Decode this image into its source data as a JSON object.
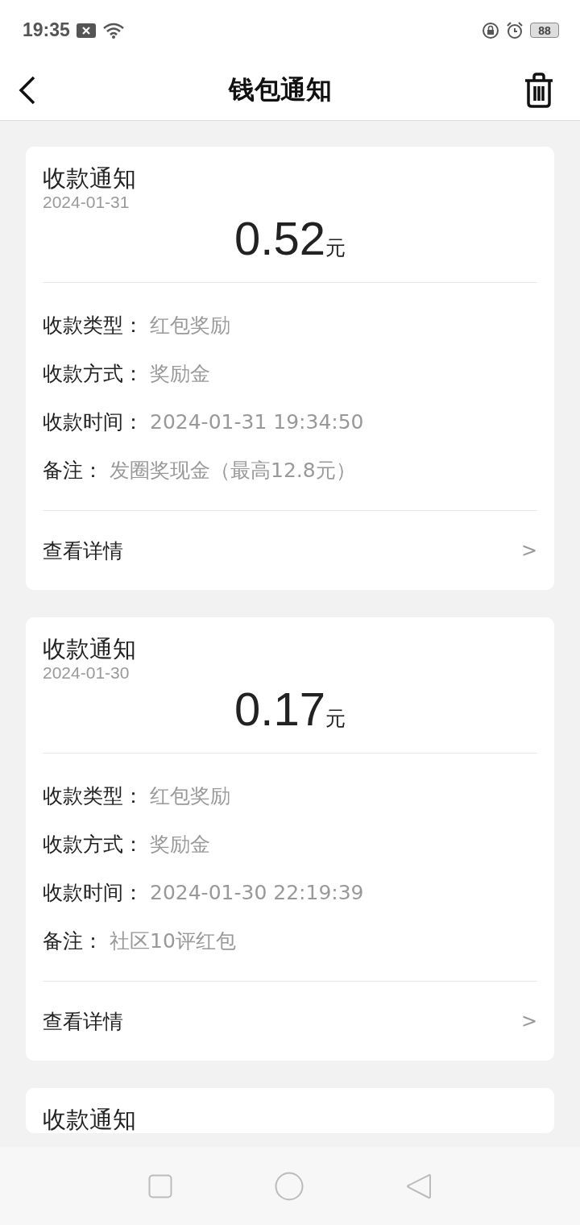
{
  "status_bar": {
    "time": "19:35",
    "battery": "88"
  },
  "header": {
    "title": "钱包通知"
  },
  "notices": [
    {
      "title": "收款通知",
      "date": "2024-01-31",
      "amount": "0.52",
      "unit": "元",
      "fields": [
        {
          "label": "收款类型：",
          "value": "红包奖励"
        },
        {
          "label": "收款方式：",
          "value": "奖励金"
        },
        {
          "label": "收款时间：",
          "value": "2024-01-31 19:34:50"
        },
        {
          "label": "备注：",
          "value": "发圈奖现金（最高12.8元）"
        }
      ],
      "link": "查看详情",
      "chevron": ">"
    },
    {
      "title": "收款通知",
      "date": "2024-01-30",
      "amount": "0.17",
      "unit": "元",
      "fields": [
        {
          "label": "收款类型：",
          "value": "红包奖励"
        },
        {
          "label": "收款方式：",
          "value": "奖励金"
        },
        {
          "label": "收款时间：",
          "value": "2024-01-30 22:19:39"
        },
        {
          "label": "备注：",
          "value": "社区10评红包"
        }
      ],
      "link": "查看详情",
      "chevron": ">"
    },
    {
      "title": "收款通知"
    }
  ]
}
